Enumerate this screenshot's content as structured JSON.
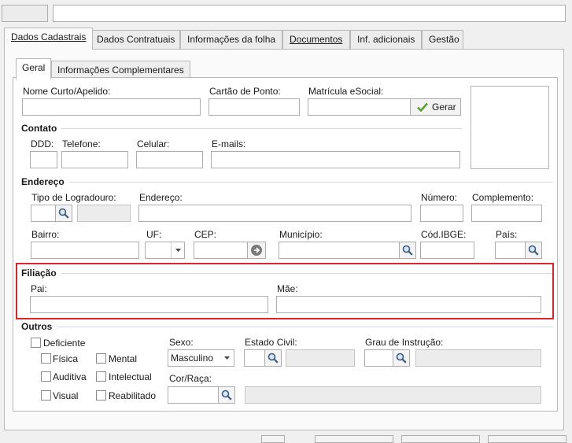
{
  "top_tabs": [
    {
      "label": "Dados Cadastrais",
      "active": true
    },
    {
      "label": "Dados Contratuais"
    },
    {
      "label": "Informações da folha"
    },
    {
      "label": "Documentos"
    },
    {
      "label": "Inf. adicionais"
    },
    {
      "label": "Gestão"
    }
  ],
  "sub_tabs": [
    {
      "label": "Geral",
      "active": true
    },
    {
      "label": "Informações Complementares"
    }
  ],
  "geral": {
    "nome_curto_label": "Nome Curto/Apelido:",
    "cartao_ponto_label": "Cartão de Ponto:",
    "matricula_label": "Matrícula eSocial:",
    "gerar_label": "Gerar"
  },
  "contato": {
    "title": "Contato",
    "ddd_label": "DDD:",
    "telefone_label": "Telefone:",
    "celular_label": "Celular:",
    "emails_label": "E-mails:"
  },
  "endereco": {
    "title": "Endereço",
    "tipo_logradouro_label": "Tipo de Logradouro:",
    "endereco_label": "Endereço:",
    "numero_label": "Número:",
    "complemento_label": "Complemento:",
    "bairro_label": "Bairro:",
    "uf_label": "UF:",
    "cep_label": "CEP:",
    "municipio_label": "Município:",
    "cod_ibge_label": "Cód.IBGE:",
    "pais_label": "País:"
  },
  "filiacao": {
    "title": "Filiação",
    "pai_label": "Pai:",
    "mae_label": "Mãe:"
  },
  "outros": {
    "title": "Outros",
    "deficiente_label": "Deficiente",
    "fisica_label": "Física",
    "mental_label": "Mental",
    "auditiva_label": "Auditiva",
    "intelectual_label": "Intelectual",
    "visual_label": "Visual",
    "reabilitado_label": "Reabilitado",
    "sexo_label": "Sexo:",
    "sexo_value": "Masculino",
    "estado_civil_label": "Estado Civil:",
    "grau_instrucao_label": "Grau de Instrução:",
    "cor_raca_label": "Cor/Raça:"
  },
  "colors": {
    "highlight": "#e0242b",
    "gerar_check": "#5aa02c"
  }
}
